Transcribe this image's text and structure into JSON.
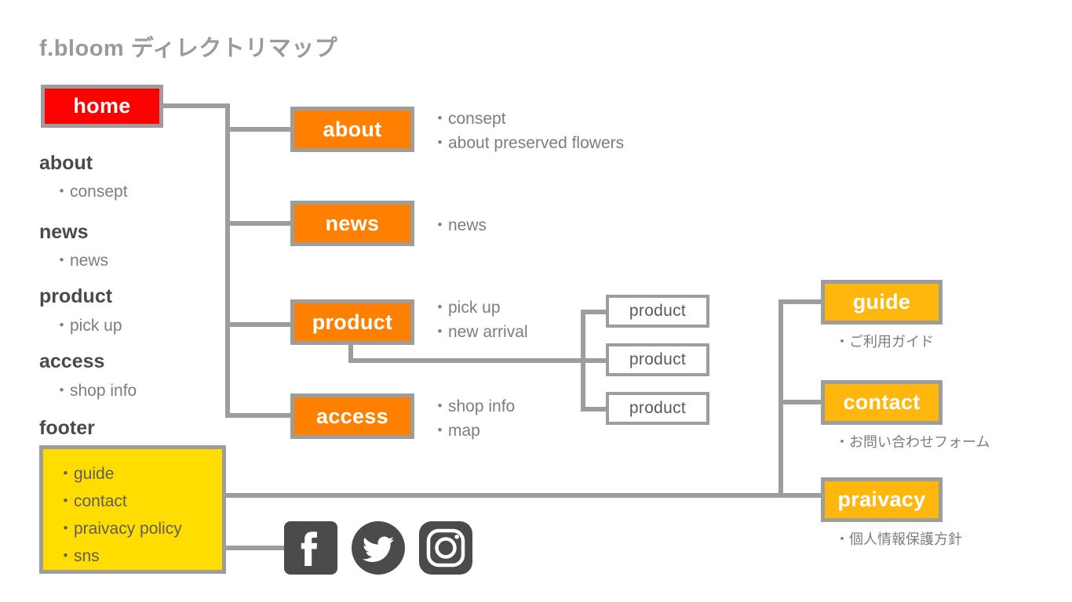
{
  "title": "f.bloom ディレクトリマップ",
  "colors": {
    "home": "#ff0000",
    "orange": "#ff8000",
    "amber": "#ffb60d",
    "footer_yellow": "#ffdd00",
    "line_gray": "#9d9d9d",
    "title_gray": "#9a9a9a"
  },
  "nodes": {
    "home": "home",
    "about": "about",
    "news": "news",
    "product": "product",
    "access": "access",
    "guide": "guide",
    "contact": "contact",
    "praivacy": "praivacy",
    "product_sub_1": "product",
    "product_sub_2": "product",
    "product_sub_3": "product"
  },
  "menu": {
    "items": [
      {
        "head": "about",
        "sub": "・consept"
      },
      {
        "head": "news",
        "sub": "・news"
      },
      {
        "head": "product",
        "sub": "・pick up"
      },
      {
        "head": "access",
        "sub": "・shop info"
      }
    ],
    "footer_head": "footer"
  },
  "footer_box": {
    "items": [
      "・guide",
      "・contact",
      "・praivacy policy",
      "・sns"
    ]
  },
  "captions": {
    "about": [
      "・consept",
      "・about preserved flowers"
    ],
    "news": [
      "・news"
    ],
    "product": [
      "・pick up",
      "・new arrival"
    ],
    "access": [
      "・shop info",
      "・map"
    ],
    "guide": [
      "・ご利用ガイド"
    ],
    "contact": [
      "・お問い合わせフォーム"
    ],
    "praivacy": [
      "・個人情報保護方針"
    ]
  },
  "sns": {
    "facebook": "facebook-icon",
    "twitter": "twitter-icon",
    "instagram": "instagram-icon"
  }
}
